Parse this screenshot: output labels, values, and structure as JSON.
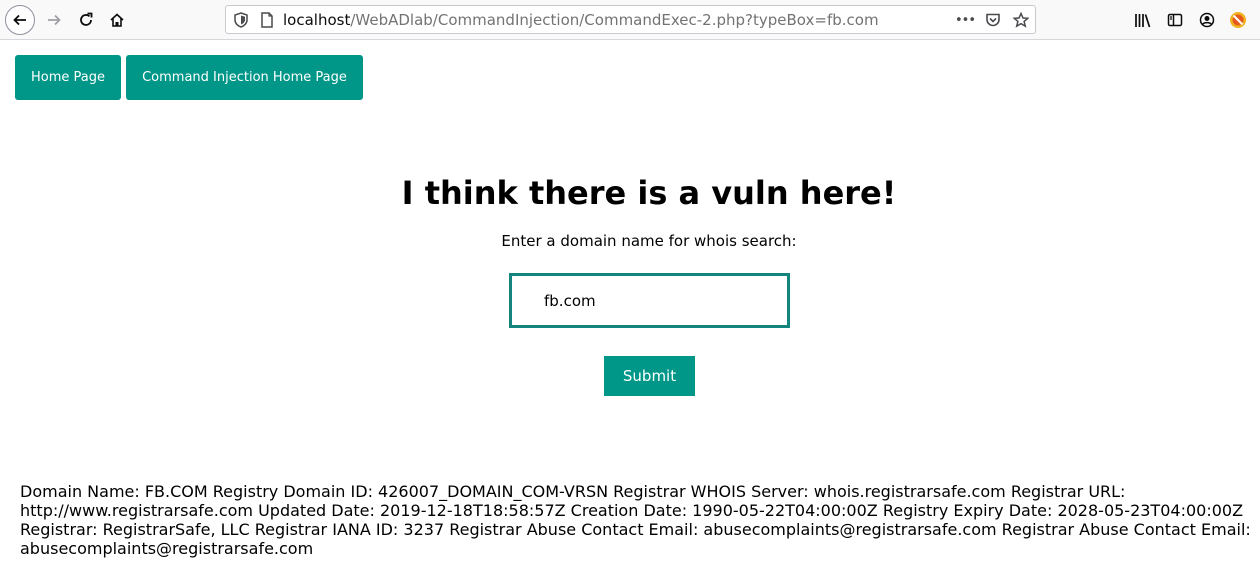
{
  "browser": {
    "url_host": "localhost",
    "url_path": "/WebADlab/CommandInjection/CommandExec-2.php?typeBox=fb.com",
    "more_label": "•••",
    "icons": [
      "back-arrow-icon",
      "forward-arrow-icon",
      "reload-icon",
      "home-icon",
      "shield-icon",
      "page-icon",
      "more-icon",
      "pocket-icon",
      "star-icon",
      "library-icon",
      "sidebar-icon",
      "account-icon",
      "extension-icon"
    ]
  },
  "nav": {
    "home_label": "Home Page",
    "cmd_label": "Command Injection Home Page"
  },
  "main": {
    "heading": "I think there is a vuln here!",
    "prompt": "Enter a domain name for whois search:",
    "input_value": "fb.com",
    "submit_label": "Submit"
  },
  "whois": {
    "lines": [
      "Domain Name: FB.COM Registry Domain ID: 426007_DOMAIN_COM-VRSN Registrar WHOIS Server: whois.registrarsafe.com Registrar URL:",
      "http://www.registrarsafe.com Updated Date: 2019-12-18T18:58:57Z Creation Date: 1990-05-22T04:00:00Z Registry Expiry Date: 2028-05-23T04:00:00Z",
      "Registrar: RegistrarSafe, LLC Registrar IANA ID: 3237 Registrar Abuse Contact Email: abusecomplaints@registrarsafe.com Registrar Abuse Contact Email:",
      "abusecomplaints@registrarsafe.com"
    ]
  },
  "colors": {
    "accent": "#009688",
    "input_border": "#13857c"
  }
}
